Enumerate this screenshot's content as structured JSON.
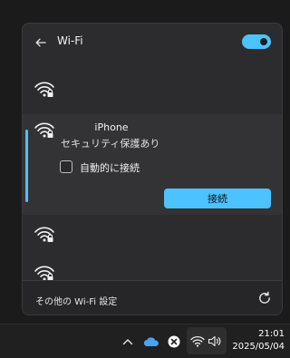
{
  "flyout": {
    "title": "Wi-Fi",
    "wifi_enabled": true
  },
  "networks": [
    {
      "secured": true
    },
    {
      "name": "iPhone",
      "status": "セキュリティ保護あり",
      "secured": true,
      "expanded": true
    },
    {
      "secured": true
    },
    {
      "secured": true
    }
  ],
  "expanded": {
    "auto_connect_label": "自動的に接続",
    "auto_connect_checked": false,
    "connect_label": "接続"
  },
  "footer": {
    "more_settings_label": "その他の Wi-Fi 設定"
  },
  "taskbar": {
    "time": "21:01",
    "date": "2025/05/04",
    "icons": [
      "chevron-up-icon",
      "onedrive-cloud-icon",
      "close-circle-icon",
      "wifi-icon",
      "speaker-icon"
    ]
  },
  "colors": {
    "accent": "#4cc2ff",
    "flyout_bg": "#2c2c2e",
    "taskbar_bg": "#202020"
  }
}
